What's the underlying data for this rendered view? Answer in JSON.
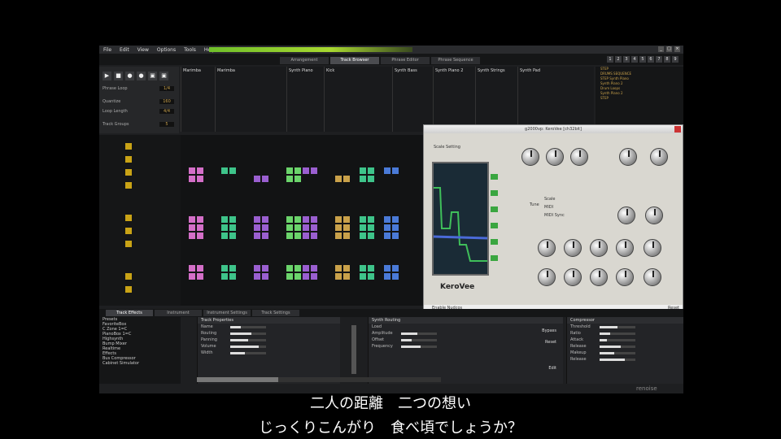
{
  "menu": [
    "File",
    "Edit",
    "View",
    "Options",
    "Tools",
    "Help"
  ],
  "main_tabs": [
    {
      "label": "Arrangement",
      "active": false
    },
    {
      "label": "Track Browser",
      "active": true
    },
    {
      "label": "Phrase Editor",
      "active": false
    },
    {
      "label": "Phrase Sequence",
      "active": false
    }
  ],
  "scene_numbers": [
    "1",
    "2",
    "3",
    "4",
    "5",
    "6",
    "7",
    "8",
    "9"
  ],
  "transport": {
    "buttons": [
      "▶",
      "■",
      "●",
      "●",
      "▣",
      "▣"
    ],
    "labels": [
      "Phrase Loop",
      "Quantize",
      "Loop Length",
      "Track Groups"
    ],
    "values": [
      "1/4",
      "160",
      "4/4",
      "5"
    ]
  },
  "scene_columns": [
    "Marimba",
    "Marimba",
    "Synth Piano",
    "Kick",
    "Synth Bass",
    "Synth Piano 2",
    "Synth Strings",
    "Synth Pad"
  ],
  "right_list": [
    "STEP",
    "DRUMS SEQUENCE",
    "STEP Synth Piano",
    "Synth Piano 2",
    "Drum Loops",
    "Synth Piano 2",
    "STEP"
  ],
  "plugin": {
    "title": "g2000vp: KeroVee [ch32bit]",
    "scale_label": "Scale Setting",
    "logo": "KeroVee",
    "enable_label": "Enable Nudcos",
    "reset_label": "Reset",
    "tune_label": "Tune",
    "radio": [
      "Scale",
      "MIDI",
      "MIDI Sync"
    ]
  },
  "bottom_tabs": [
    {
      "label": "Track Effects",
      "active": true
    },
    {
      "label": "Instrument",
      "active": false
    },
    {
      "label": "Instrument Settings",
      "active": false
    },
    {
      "label": "Track Settings",
      "active": false
    }
  ],
  "browser": [
    "Presets",
    "FavoriteBox",
    "C Zone 1=C",
    "PianoBox 1=C",
    "Highsynth",
    "Bump Mixer",
    "Realtime",
    "Effects",
    "Bus Compressor",
    "Cabinet Simulator"
  ],
  "panel_left": {
    "header": "Track Properties",
    "rows": [
      "Name",
      "Routing",
      "Panning",
      "Volume",
      "Width"
    ]
  },
  "panel_mid": {
    "header": "Synth Routing",
    "rows": [
      "Load",
      "Amplitude",
      "Offset",
      "Frequency"
    ],
    "buttons": [
      "Bypass",
      "Reset",
      "Edit"
    ]
  },
  "panel_right": {
    "header": "Compressor",
    "rows": [
      "Threshold",
      "Ratio",
      "Attack",
      "Release",
      "Makeup",
      "Release"
    ]
  },
  "brand": "renoise",
  "subtitles": [
    "二人の距離　二つの想い",
    "じっくりこんがり　食べ頃でしょうか？"
  ]
}
